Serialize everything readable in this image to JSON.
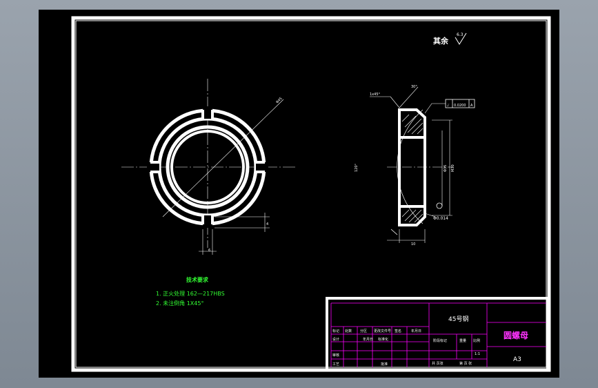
{
  "roughness": {
    "label": "其余",
    "symbol_value": "6.3"
  },
  "front_view": {
    "dims": {
      "outer_dia": "Φ45",
      "slot_depth": "4",
      "slot_width": "6"
    }
  },
  "side_view": {
    "dims": {
      "chamfer": "1x45°",
      "thread": "M30",
      "bore": "Φ35",
      "thickness": "10",
      "angle": "30°",
      "arc_radius": "120°",
      "runout_value": "Φ0.014"
    },
    "tolerance_frame": {
      "symbol": "⌰",
      "value": "0.0200",
      "datum": "A"
    }
  },
  "tech_requirements": {
    "title": "技术要求",
    "items": [
      "1. 正火处理 162—217HBS",
      "2. 未注倒角 1X45°"
    ]
  },
  "title_block": {
    "material": "45号钢",
    "part_name": "圆螺母",
    "sheet_size": "A3",
    "scale": "1:1",
    "row_labels": [
      "标记",
      "处数",
      "分区",
      "更改文件号",
      "签名",
      "年月日"
    ],
    "left_labels": [
      "设计",
      "审核",
      "工艺"
    ],
    "design_cols": [
      "年月日",
      "标准化"
    ],
    "approve": "批准",
    "stage_labels": [
      "阶段标记",
      "重量",
      "比例"
    ],
    "sheet_info": [
      "共 页张",
      "第 页 张"
    ]
  },
  "colors": {
    "line": "#ffffff",
    "center": "#ffffff",
    "frame": "#ffffff",
    "magenta": "#ff00ff",
    "green": "#33ff33",
    "yellow": "#ffff33"
  }
}
